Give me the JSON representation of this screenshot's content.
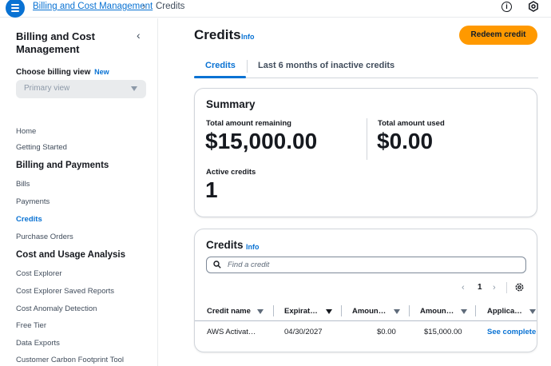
{
  "topbar": {
    "breadcrumb_parent": "Billing and Cost Management",
    "breadcrumb_separator": "›",
    "breadcrumb_current": "Credits",
    "info_glyph": "i"
  },
  "sidebar": {
    "title": "Billing and Cost Management",
    "close_glyph": "‹",
    "billing_view_label": "Choose billing view",
    "billing_view_badge": "New",
    "billing_view_value": "Primary view",
    "items": [
      {
        "label": "Home"
      },
      {
        "label": "Getting Started"
      },
      {
        "label": "Billing and Payments"
      },
      {
        "label": "Bills"
      },
      {
        "label": "Payments"
      },
      {
        "label": "Credits",
        "active": true
      },
      {
        "label": "Purchase Orders"
      },
      {
        "label": "Cost and Usage Analysis"
      },
      {
        "label": "Cost Explorer"
      },
      {
        "label": "Cost Explorer Saved Reports"
      },
      {
        "label": "Cost Anomaly Detection"
      },
      {
        "label": "Free Tier"
      },
      {
        "label": "Data Exports"
      },
      {
        "label": "Customer Carbon Footprint Tool"
      }
    ]
  },
  "main": {
    "title": "Credits",
    "info_label": "Info",
    "redeem_label": "Redeem credit",
    "tabs": [
      {
        "label": "Credits",
        "active": true
      },
      {
        "label": "Last 6 months of inactive credits"
      }
    ]
  },
  "summary": {
    "heading": "Summary",
    "total_remaining_label": "Total amount remaining",
    "total_remaining_value": "$15,000.00",
    "total_used_label": "Total amount used",
    "total_used_value": "$0.00",
    "active_credits_label": "Active credits",
    "active_credits_value": "1"
  },
  "credits_table": {
    "heading": "Credits",
    "info_label": "Info",
    "search_placeholder": "Find a credit",
    "page_number": "1",
    "prev_glyph": "‹",
    "next_glyph": "›",
    "columns": [
      "Credit name",
      "Expirat…",
      "Amoun…",
      "Amoun…",
      "Applica…"
    ],
    "rows": [
      {
        "credit_name": "AWS Activat…",
        "expiration": "04/30/2027",
        "amount_used": "$0.00",
        "amount_remaining": "$15,000.00",
        "applicable": "See complete"
      }
    ]
  },
  "colors": {
    "accent": "#0972d3",
    "primary_button": "#ff9900",
    "text": "#16191f"
  },
  "icons": {
    "menu": "menu-icon",
    "info": "info-circle-icon",
    "settings": "settings-icon",
    "search": "search-icon",
    "gear": "gear-icon"
  }
}
